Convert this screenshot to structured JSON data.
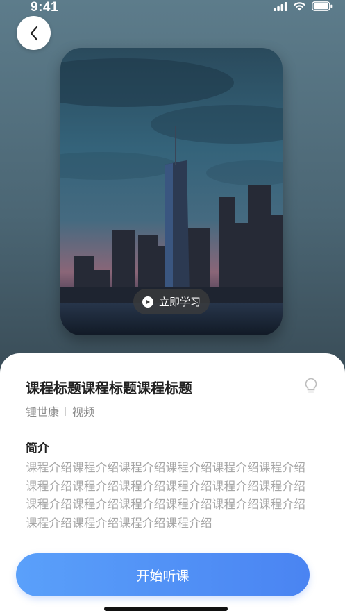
{
  "status": {
    "time": "9:41"
  },
  "cover": {
    "study_label": "立即学习"
  },
  "course": {
    "title": "课程标题课程标题课程标题",
    "author": "锺世康",
    "type": "视频",
    "intro_heading": "简介",
    "intro_text": "课程介绍课程介绍课程介绍课程介绍课程介绍课程介绍课程介绍课程介绍课程介绍课程介绍课程介绍课程介绍课程介绍课程介绍课程介绍课程介绍课程介绍课程介绍课程介绍课程介绍课程介绍课程介绍"
  },
  "actions": {
    "start_label": "开始听课"
  },
  "icons": {
    "back": "chevron-left-icon",
    "play": "play-icon",
    "bulb": "lightbulb-icon",
    "signal": "cellular-signal-icon",
    "wifi": "wifi-icon",
    "battery": "battery-icon"
  },
  "colors": {
    "accent_start": "#5aa0fa",
    "accent_end": "#4a84f2"
  }
}
